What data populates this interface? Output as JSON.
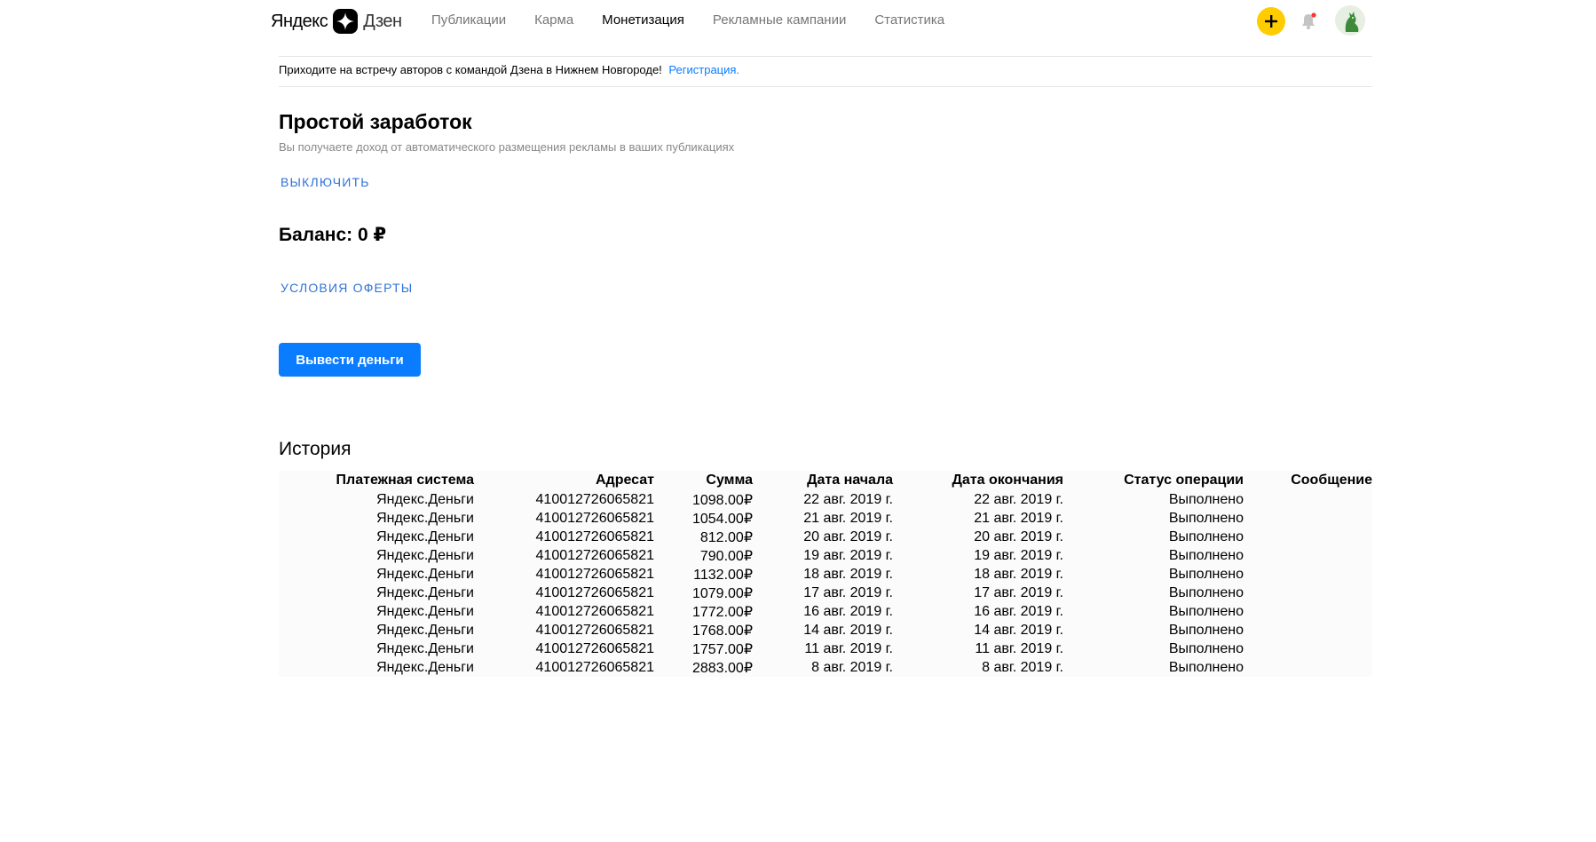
{
  "header": {
    "logo_left": "Яндекс",
    "logo_right": "Дзен",
    "nav": [
      {
        "label": "Публикации",
        "active": false
      },
      {
        "label": "Карма",
        "active": false
      },
      {
        "label": "Монетизация",
        "active": true
      },
      {
        "label": "Рекламные кампании",
        "active": false
      },
      {
        "label": "Статистика",
        "active": false
      }
    ],
    "accent_color": "#ffcc00",
    "notification_dot_color": "#ff3333"
  },
  "notice": {
    "text": "Приходите на встречу авторов с командой Дзена в Нижнем Новгороде!",
    "link": "Регистрация."
  },
  "simple_earnings": {
    "title": "Простой заработок",
    "description": "Вы получаете доход от автоматического размещения рекламы в ваших публикациях",
    "disable_link": "выключить"
  },
  "balance": {
    "label": "Баланс: 0 ₽",
    "offer_link": "условия оферты",
    "withdraw_button": "Вывести деньги",
    "button_color": "#0a7cff"
  },
  "history": {
    "title": "История",
    "columns": [
      "Платежная система",
      "Адресат",
      "Сумма",
      "Дата начала",
      "Дата окончания",
      "Статус операции",
      "Сообщение"
    ],
    "rows": [
      [
        "Яндекс.Деньги",
        "410012726065821",
        "1098.00₽",
        "22 авг. 2019 г.",
        "22 авг. 2019 г.",
        "Выполнено",
        ""
      ],
      [
        "Яндекс.Деньги",
        "410012726065821",
        "1054.00₽",
        "21 авг. 2019 г.",
        "21 авг. 2019 г.",
        "Выполнено",
        ""
      ],
      [
        "Яндекс.Деньги",
        "410012726065821",
        "812.00₽",
        "20 авг. 2019 г.",
        "20 авг. 2019 г.",
        "Выполнено",
        ""
      ],
      [
        "Яндекс.Деньги",
        "410012726065821",
        "790.00₽",
        "19 авг. 2019 г.",
        "19 авг. 2019 г.",
        "Выполнено",
        ""
      ],
      [
        "Яндекс.Деньги",
        "410012726065821",
        "1132.00₽",
        "18 авг. 2019 г.",
        "18 авг. 2019 г.",
        "Выполнено",
        ""
      ],
      [
        "Яндекс.Деньги",
        "410012726065821",
        "1079.00₽",
        "17 авг. 2019 г.",
        "17 авг. 2019 г.",
        "Выполнено",
        ""
      ],
      [
        "Яндекс.Деньги",
        "410012726065821",
        "1772.00₽",
        "16 авг. 2019 г.",
        "16 авг. 2019 г.",
        "Выполнено",
        ""
      ],
      [
        "Яндекс.Деньги",
        "410012726065821",
        "1768.00₽",
        "14 авг. 2019 г.",
        "14 авг. 2019 г.",
        "Выполнено",
        ""
      ],
      [
        "Яндекс.Деньги",
        "410012726065821",
        "1757.00₽",
        "11 авг. 2019 г.",
        "11 авг. 2019 г.",
        "Выполнено",
        ""
      ],
      [
        "Яндекс.Деньги",
        "410012726065821",
        "2883.00₽",
        "8 авг. 2019 г.",
        "8 авг. 2019 г.",
        "Выполнено",
        ""
      ]
    ]
  }
}
